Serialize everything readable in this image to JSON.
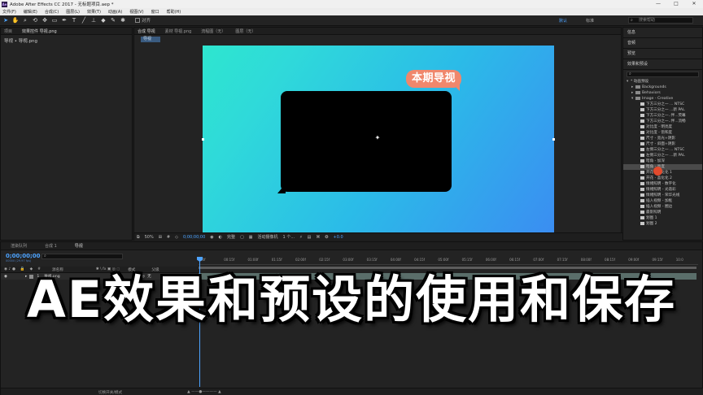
{
  "app": {
    "title": "Adobe After Effects CC 2017 - 无标题项目.aep *",
    "window_controls": [
      "—",
      "□",
      "✕"
    ]
  },
  "menu": [
    "文件(F)",
    "编辑(E)",
    "合成(C)",
    "图层(L)",
    "效果(T)",
    "动画(A)",
    "视图(V)",
    "窗口",
    "帮助(H)"
  ],
  "toolbar": {
    "tools": [
      "select-tool",
      "hand-tool",
      "zoom-tool",
      "orbit-tool",
      "move-under-tool",
      "rect-tool",
      "pen-tool",
      "text-tool",
      "brush-tool",
      "stamp-tool",
      "eraser-tool",
      "roto-tool",
      "puppet-tool"
    ],
    "snap_label": "对齐",
    "workspace_default": "默认",
    "workspace_standard": "标准",
    "search_placeholder": "搜索帮助"
  },
  "left_panel": {
    "tabs": [
      "项目",
      "效果控件 导视.png"
    ],
    "breadcrumb": "导视 • 导视.png"
  },
  "comp_panel": {
    "tabs": [
      "合成 导视",
      "素材 导视.png",
      "流程图（无）",
      "图层（无）"
    ],
    "crumb": "导视",
    "badge_text": "本期导视",
    "viewer_bar": {
      "zoom": "50%",
      "timecode": "0;00;00;00",
      "resolution": "完整",
      "camera": "活动摄像机",
      "views": "1 个...",
      "exposure": "+0.0"
    }
  },
  "right_panel": {
    "sections": [
      "信息",
      "音频",
      "预览"
    ],
    "effects_title": "效果和预设",
    "tree": [
      {
        "label": "* 动画预设",
        "level": 0,
        "kind": "open"
      },
      {
        "label": "Backgrounds",
        "level": 1,
        "kind": "folder"
      },
      {
        "label": "Behaviors",
        "level": 1,
        "kind": "folder"
      },
      {
        "label": "Image - Creative",
        "level": 1,
        "kind": "folder-open"
      },
      {
        "label": "下方三分之一 ... NTSC",
        "level": 2,
        "kind": "fx"
      },
      {
        "label": "下方三分之一 ...新 PAL",
        "level": 2,
        "kind": "fx"
      },
      {
        "label": "下方三分之一..伴...荧幕",
        "level": 2,
        "kind": "fx"
      },
      {
        "label": "下方三分之一..伴...流畅",
        "level": 2,
        "kind": "fx"
      },
      {
        "label": "对比度 - 明亮度",
        "level": 2,
        "kind": "fx"
      },
      {
        "label": "对比度 - 饱和度",
        "level": 2,
        "kind": "fx"
      },
      {
        "label": "尺寸 - 宽光+阴影",
        "level": 2,
        "kind": "fx"
      },
      {
        "label": "尺寸 - 斜面+阴影",
        "level": 2,
        "kind": "fx"
      },
      {
        "label": "左侧三分之一 ... NTSC",
        "level": 2,
        "kind": "fx"
      },
      {
        "label": "左侧三分之一 ...新 PAL",
        "level": 2,
        "kind": "fx"
      },
      {
        "label": "暗角 - 加深",
        "level": 2,
        "kind": "fx"
      },
      {
        "label": "暗角 - 亮度",
        "level": 2,
        "kind": "fx",
        "selected": true
      },
      {
        "label": "开花 - 晶化化 1",
        "level": 2,
        "kind": "fx"
      },
      {
        "label": "开花 - 晶化化 2",
        "level": 2,
        "kind": "fx"
      },
      {
        "label": "情绪照明 - 数字化",
        "level": 2,
        "kind": "fx"
      },
      {
        "label": "情绪照明 - 光谐彩",
        "level": 2,
        "kind": "fx"
      },
      {
        "label": "情绪照明 - 荣华光线",
        "level": 2,
        "kind": "fx"
      },
      {
        "label": "插入视频 - 加框",
        "level": 2,
        "kind": "fx"
      },
      {
        "label": "插入视频 - 圈边",
        "level": 2,
        "kind": "fx"
      },
      {
        "label": "最影照明",
        "level": 2,
        "kind": "fx"
      },
      {
        "label": "划图 1",
        "level": 2,
        "kind": "fx"
      },
      {
        "label": "划图 2",
        "level": 2,
        "kind": "fx"
      }
    ]
  },
  "timeline": {
    "tabs": [
      "渲染队列",
      "合成 1",
      "导视"
    ],
    "time": "0;00;00;00",
    "fps": "00000 (29.97 fps)",
    "columns": {
      "name": "源名称",
      "mode": "模式",
      "parent": "父级"
    },
    "layer": {
      "index": "1",
      "name": "导视.png",
      "parent": "无"
    },
    "ruler_ticks": [
      "00f",
      "00:15f",
      "01:00f",
      "01:15f",
      "02:00f",
      "02:15f",
      "03:00f",
      "03:15f",
      "04:00f",
      "04:15f",
      "05:00f",
      "05:15f",
      "06:00f",
      "06:15f",
      "07:00f",
      "07:15f",
      "08:00f",
      "08:15f",
      "09:00f",
      "09:15f",
      "10:0"
    ],
    "bottom_label": "切换开关/模式"
  },
  "headline": "AE效果和预设的使用和保存"
}
